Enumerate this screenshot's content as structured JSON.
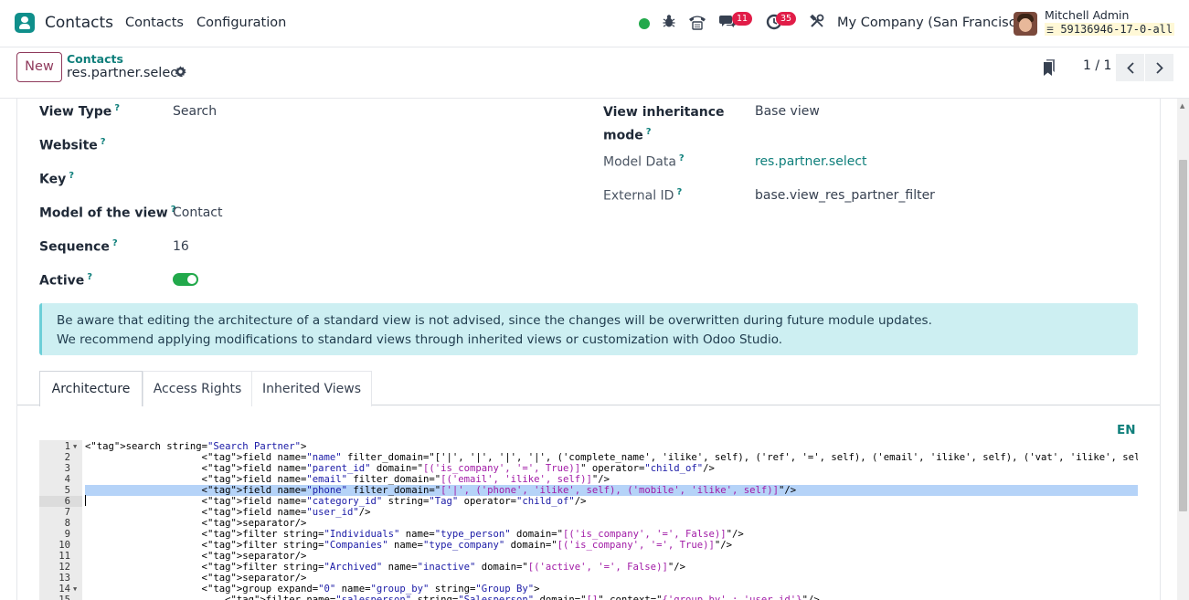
{
  "navbar": {
    "app_name": "Contacts",
    "menu": [
      "Contacts",
      "Configuration"
    ],
    "messages_count": "11",
    "activities_count": "35",
    "company": "My Company (San Francisco)",
    "user_name": "Mitchell Admin",
    "database": "59136946-17-0-all",
    "status_color": "#22a94b"
  },
  "control": {
    "new_label": "New",
    "breadcrumb_parent": "Contacts",
    "breadcrumb_current": "res.partner.select",
    "pager": "1 / 1"
  },
  "form": {
    "left": [
      {
        "label": "View Type",
        "value": "Search"
      },
      {
        "label": "Website",
        "value": ""
      },
      {
        "label": "Key",
        "value": ""
      },
      {
        "label": "Model of the view",
        "value": "Contact"
      },
      {
        "label": "Sequence",
        "value": "16"
      },
      {
        "label": "Active",
        "value": ""
      }
    ],
    "right": [
      {
        "label_line1": "View inheritance",
        "label_line2": "mode",
        "value": "Base view"
      },
      {
        "label": "Model Data",
        "value": "res.partner.select"
      },
      {
        "label": "External ID",
        "value": "base.view_res_partner_filter"
      }
    ],
    "active": true,
    "help_marker": "?"
  },
  "alert": {
    "line1": "Be aware that editing the architecture of a standard view is not advised, since the changes will be overwritten during future module updates.",
    "line2": "We recommend applying modifications to standard views through inherited views or customization with Odoo Studio."
  },
  "tabs": [
    "Architecture",
    "Access Rights",
    "Inherited Views"
  ],
  "editor": {
    "lang": "EN",
    "lines": [
      "<search string=\"Search Partner\">",
      "                    <field name=\"name\" filter_domain=\"['|', '|', '|', '|', ('complete_name', 'ilike', self), ('ref', '=', self), ('email', 'ilike', self), ('vat', 'ilike', self), ('company_reg",
      "                    <field name=\"parent_id\" domain=\"[('is_company', '=', True)]\" operator=\"child_of\"/>",
      "                    <field name=\"email\" filter_domain=\"[('email', 'ilike', self)]\"/>",
      "                    <field name=\"phone\" filter_domain=\"['|', ('phone', 'ilike', self), ('mobile', 'ilike', self)]\"/>",
      "                    <field name=\"category_id\" string=\"Tag\" operator=\"child_of\"/>",
      "                    <field name=\"user_id\"/>",
      "                    <separator/>",
      "                    <filter string=\"Individuals\" name=\"type_person\" domain=\"[('is_company', '=', False)]\"/>",
      "                    <filter string=\"Companies\" name=\"type_company\" domain=\"[('is_company', '=', True)]\"/>",
      "                    <separator/>",
      "                    <filter string=\"Archived\" name=\"inactive\" domain=\"[('active', '=', False)]\"/>",
      "                    <separator/>",
      "                    <group expand=\"0\" name=\"group_by\" string=\"Group By\">",
      "                        <filter name=\"salesperson\" string=\"Salesperson\" domain=\"[]\" context=\"{'group_by' : 'user_id'}\"/>"
    ],
    "highlighted_line": 5,
    "active_line": 6
  }
}
